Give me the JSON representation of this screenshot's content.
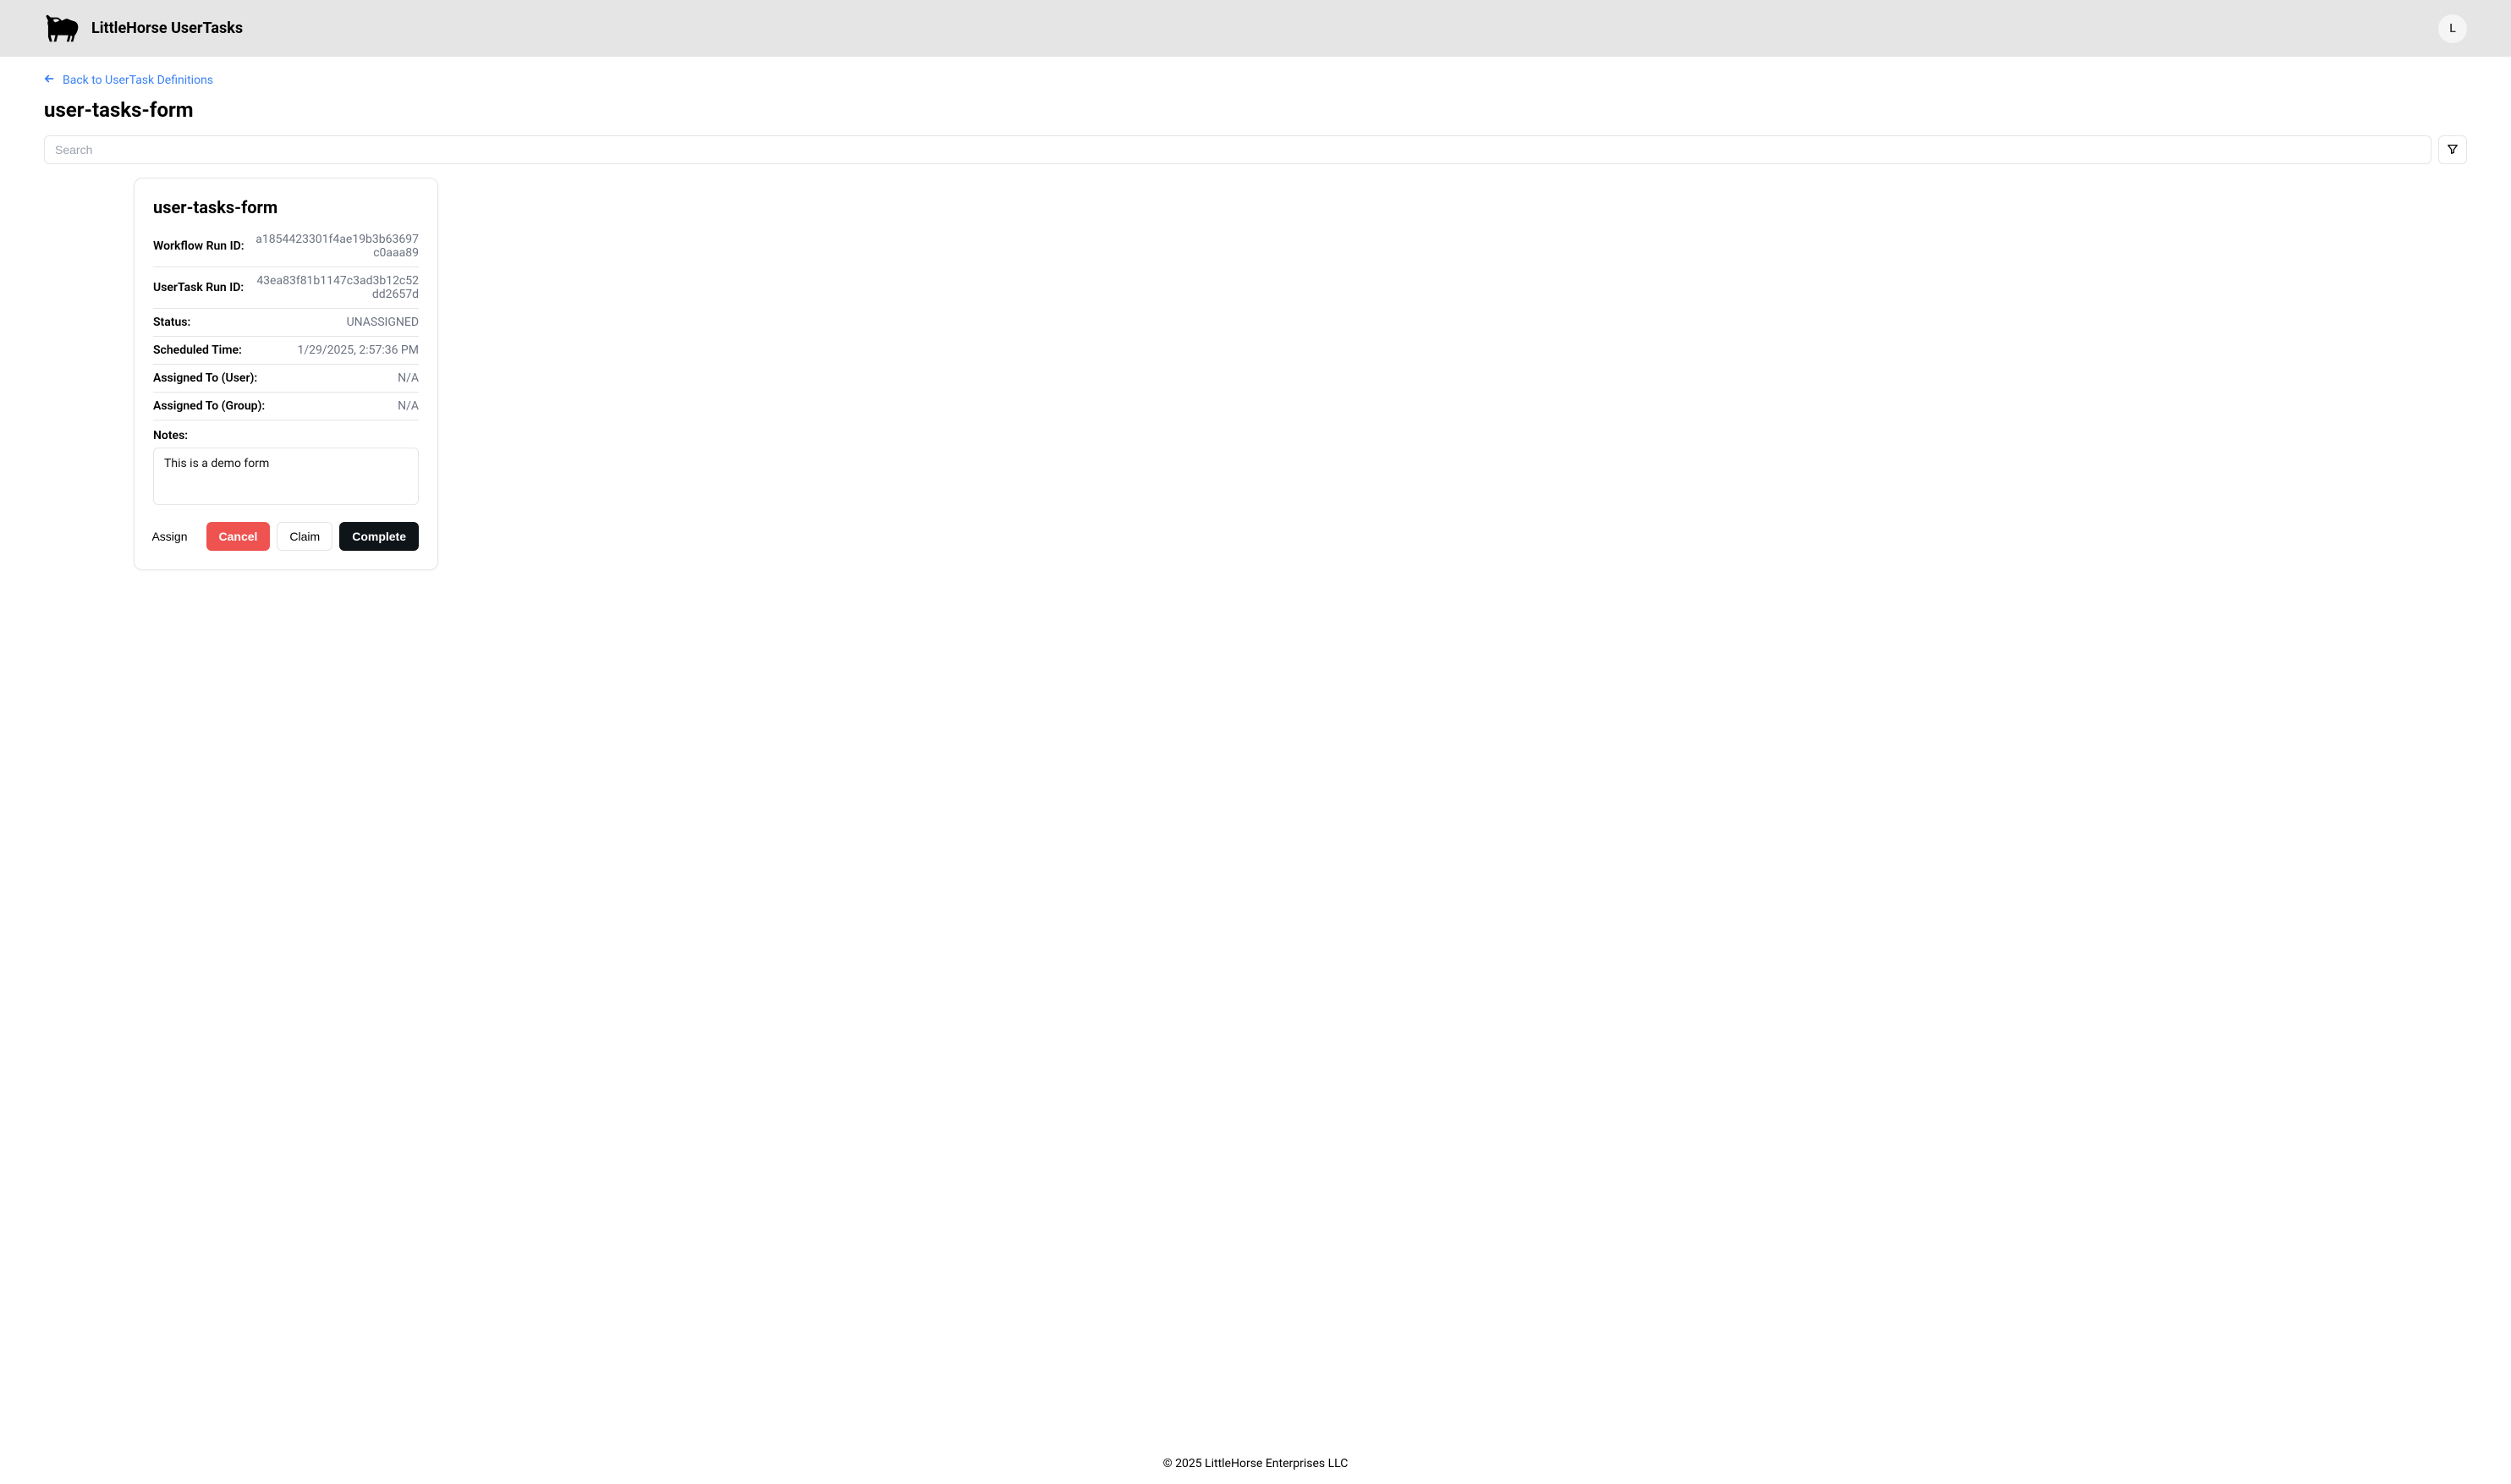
{
  "header": {
    "app_title": "LittleHorse UserTasks",
    "avatar_initial": "L"
  },
  "nav": {
    "back_link_label": "Back to UserTask Definitions"
  },
  "page": {
    "title": "user-tasks-form"
  },
  "search": {
    "placeholder": "Search"
  },
  "card": {
    "title": "user-tasks-form",
    "details": {
      "workflow_run_id_label": "Workflow Run ID:",
      "workflow_run_id_value": "a1854423301f4ae19b3b63697c0aaa89",
      "usertask_run_id_label": "UserTask Run ID:",
      "usertask_run_id_value": "43ea83f81b1147c3ad3b12c52dd2657d",
      "status_label": "Status:",
      "status_value": "UNASSIGNED",
      "scheduled_time_label": "Scheduled Time:",
      "scheduled_time_value": "1/29/2025, 2:57:36 PM",
      "assigned_user_label": "Assigned To (User):",
      "assigned_user_value": "N/A",
      "assigned_group_label": "Assigned To (Group):",
      "assigned_group_value": "N/A"
    },
    "notes": {
      "label": "Notes:",
      "value": "This is a demo form"
    },
    "buttons": {
      "assign": "Assign",
      "cancel": "Cancel",
      "claim": "Claim",
      "complete": "Complete"
    }
  },
  "footer": {
    "text": "© 2025 LittleHorse Enterprises LLC"
  }
}
